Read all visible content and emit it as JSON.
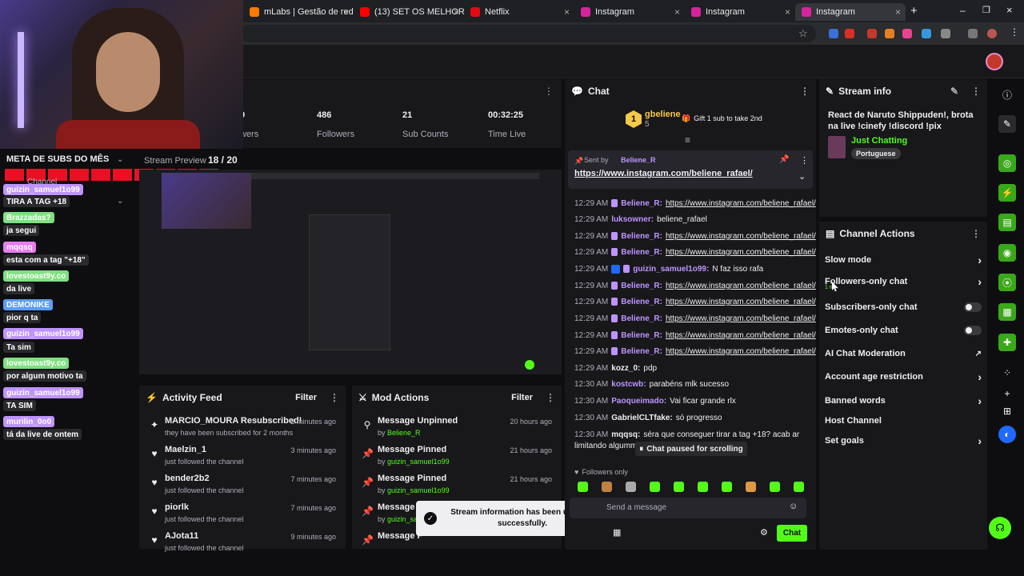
{
  "tabs": [
    {
      "label": "mLabs | Gestão de redes",
      "color": "#ff7a00"
    },
    {
      "label": "(13) SET OS MELHORES M",
      "color": "#ff0000"
    },
    {
      "label": "Netflix",
      "color": "#e50914"
    },
    {
      "label": "Instagram",
      "color": "#d6249f"
    },
    {
      "label": "Instagram",
      "color": "#d6249f"
    },
    {
      "label": "Instagram",
      "color": "#d6249f"
    }
  ],
  "new_tab": "+",
  "stats": [
    {
      "value": "9",
      "label": "wers"
    },
    {
      "value": "486",
      "label": "Followers"
    },
    {
      "value": "21",
      "label": "Sub Counts"
    },
    {
      "value": "00:32:25",
      "label": "Time Live"
    }
  ],
  "overlay": {
    "meta_title": "META DE SUBS DO MÊS",
    "meta_count": "18 / 20",
    "stream_preview": "Stream Preview",
    "channel_label": "Channel",
    "chat": [
      {
        "text": "guizin_samuel1o99",
        "bg": "#bf94ff"
      },
      {
        "text": "TIRA A TAG +18",
        "bg": "#2a2a2e"
      },
      {
        "text": "Brazzadas?",
        "bg": "#7fe07f"
      },
      {
        "text": "ja segui",
        "bg": "#2a2a2e"
      },
      {
        "text": "mqqsq",
        "bg": "#e87cf0"
      },
      {
        "text": "esta com a tag \"+18\"",
        "bg": "#2a2a2e"
      },
      {
        "text": "lovestoast9y.co",
        "bg": "#7fe07f"
      },
      {
        "text": "da live",
        "bg": "#2a2a2e"
      },
      {
        "text": "DEMONIKE",
        "bg": "#5c9bff"
      },
      {
        "text": "pior q ta",
        "bg": "#2a2a2e"
      },
      {
        "text": "guizin_samuel1o99",
        "bg": "#bf94ff"
      },
      {
        "text": "Ta sim",
        "bg": "#2a2a2e"
      },
      {
        "text": "lovestoast9y.co",
        "bg": "#7fe07f"
      },
      {
        "text": "por algum motivo ta",
        "bg": "#2a2a2e"
      },
      {
        "text": "guizin_samuel1o99",
        "bg": "#bf94ff"
      },
      {
        "text": "TA SIM",
        "bg": "#2a2a2e"
      },
      {
        "text": "murilin_0o0",
        "bg": "#bf94ff"
      },
      {
        "text": "tá da live de ontem",
        "bg": "#2a2a2e"
      }
    ]
  },
  "activity": {
    "title": "Activity Feed",
    "filter": "Filter",
    "items": [
      {
        "title": "MARCIO_MOURA Resubscribed!",
        "sub": "they have been subscribed for 2 months",
        "time": "2 minutes ago",
        "icon": "star-icon"
      },
      {
        "title": "Maelzin_1",
        "sub": "just followed the channel",
        "time": "3 minutes ago",
        "icon": "heart-icon"
      },
      {
        "title": "bender2b2",
        "sub": "just followed the channel",
        "time": "7 minutes ago",
        "icon": "heart-icon"
      },
      {
        "title": "piorlk",
        "sub": "just followed the channel",
        "time": "7 minutes ago",
        "icon": "heart-icon"
      },
      {
        "title": "AJota11",
        "sub": "just followed the channel",
        "time": "9 minutes ago",
        "icon": "heart-icon"
      }
    ]
  },
  "mod": {
    "title": "Mod Actions",
    "filter": "Filter",
    "items": [
      {
        "title": "Message Unpinned",
        "by": "by",
        "user": "Beliene_R",
        "time": "20 hours ago"
      },
      {
        "title": "Message Pinned",
        "by": "by",
        "user": "guizin_samuel1o99",
        "time": "21 hours ago"
      },
      {
        "title": "Message Pinned",
        "by": "by",
        "user": "guizin_samuel1o99",
        "time": "21 hours ago"
      },
      {
        "title": "Message P",
        "by": "by",
        "user": "guizin_sa",
        "time": ""
      },
      {
        "title": "Message P",
        "by": "by",
        "user": "",
        "time": ""
      }
    ],
    "toast": "Stream information has been updated successfully."
  },
  "chat": {
    "title": "Chat",
    "gift_user": "gbeliene",
    "gift_count": "5",
    "gift_rank": "1",
    "gift_text": "Gift 1 sub to take 2nd",
    "pinned_sender": "Sent by",
    "pinned_user": "Beliene_R",
    "pinned_link": "https://www.instagram.com/beliene_rafael/",
    "messages": [
      {
        "time": "12:29 AM",
        "user": "Beliene_R:",
        "text": "https://www.instagram.com/beliene_rafael/",
        "color": "#bf94ff",
        "link": true
      },
      {
        "time": "12:29 AM",
        "user": "luksowner:",
        "text": "beliene_rafael",
        "color": "#bf94ff",
        "link": false
      },
      {
        "time": "12:29 AM",
        "user": "Beliene_R:",
        "text": "https://www.instagram.com/beliene_rafael/",
        "color": "#bf94ff",
        "link": true
      },
      {
        "time": "12:29 AM",
        "user": "Beliene_R:",
        "text": "https://www.instagram.com/beliene_rafael/",
        "color": "#bf94ff",
        "link": true
      },
      {
        "time": "12:29 AM",
        "user": "guizin_samuel1o99:",
        "text": "N faz isso rafa",
        "color": "#bf94ff",
        "link": false
      },
      {
        "time": "12:29 AM",
        "user": "Beliene_R:",
        "text": "https://www.instagram.com/beliene_rafael/",
        "color": "#bf94ff",
        "link": true
      },
      {
        "time": "12:29 AM",
        "user": "Beliene_R:",
        "text": "https://www.instagram.com/beliene_rafael/",
        "color": "#bf94ff",
        "link": true
      },
      {
        "time": "12:29 AM",
        "user": "Beliene_R:",
        "text": "https://www.instagram.com/beliene_rafael/",
        "color": "#bf94ff",
        "link": true
      },
      {
        "time": "12:29 AM",
        "user": "Beliene_R:",
        "text": "https://www.instagram.com/beliene_rafael/",
        "color": "#bf94ff",
        "link": true
      },
      {
        "time": "12:29 AM",
        "user": "Beliene_R:",
        "text": "https://www.instagram.com/beliene_rafael/",
        "color": "#bf94ff",
        "link": true
      },
      {
        "time": "12:29 AM",
        "user": "kozz_0:",
        "text": "pdp",
        "color": "#efeff1",
        "link": false
      },
      {
        "time": "12:30 AM",
        "user": "kostcwb:",
        "text": "parabéns mlk sucesso",
        "color": "#bf94ff",
        "link": false
      },
      {
        "time": "12:30 AM",
        "user": "Paoqueimado:",
        "text": "Vai ficar grande rlx",
        "color": "#bf94ff",
        "link": false
      },
      {
        "time": "12:30 AM",
        "user": "GabrielCLTfake:",
        "text": "só progresso",
        "color": "#efeff1",
        "link": false
      },
      {
        "time": "12:30 AM",
        "user": "mqqsq:",
        "text": "séra que conseguer tirar a tag +18? acab ar",
        "color": "#efeff1",
        "link": false
      },
      {
        "time": "",
        "user": "",
        "text": "limitando algumma",
        "color": "#efeff1",
        "link": false
      }
    ],
    "paused": "Chat paused for scrolling",
    "followers_only": "Followers only",
    "input_placeholder": "Send a message",
    "chat_button": "Chat"
  },
  "stream_info": {
    "title": "Stream info",
    "stream_title": "React de Naruto Shippuden!, brota na live !cinefy !discord !pix",
    "category": "Just Chatting",
    "language": "Portuguese"
  },
  "channel_actions": {
    "title": "Channel Actions",
    "items": [
      {
        "label": "Slow mode",
        "control": "arrow"
      },
      {
        "label": "Followers-only chat",
        "control": "arrow"
      },
      {
        "label": "Subscribers-only chat",
        "control": "toggle"
      },
      {
        "label": "Emotes-only chat",
        "control": "toggle"
      },
      {
        "label": "AI Chat Moderation",
        "control": "external"
      },
      {
        "label": "Account age restriction",
        "control": "arrow"
      },
      {
        "label": "Banned words",
        "control": "arrow"
      },
      {
        "label": "Host Channel",
        "control": "none"
      },
      {
        "label": "Set goals",
        "control": "arrow"
      }
    ],
    "followers_sub": "1 m"
  },
  "colors": {
    "accent": "#53fc18",
    "purple": "#bf94ff",
    "bg": "#0e0e10",
    "panel": "#18181b"
  }
}
